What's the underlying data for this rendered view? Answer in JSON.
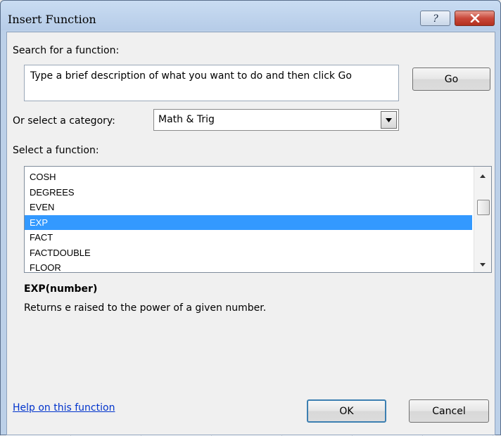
{
  "dialog": {
    "title": "Insert Function",
    "help_glyph": "?",
    "close_glyph": "✕"
  },
  "search": {
    "label": "Search for a function:",
    "value": "Type a brief description of what you want to do and then click Go",
    "go_label": "Go"
  },
  "category": {
    "label": "Or select a category:",
    "selected": "Math & Trig"
  },
  "functions": {
    "label": "Select a function:",
    "items": [
      "COSH",
      "DEGREES",
      "EVEN",
      "EXP",
      "FACT",
      "FACTDOUBLE",
      "FLOOR"
    ],
    "selected_index": 3,
    "scroll_position": 0.28
  },
  "details": {
    "signature": "EXP(number)",
    "description": "Returns e raised to the power of a given number."
  },
  "footer": {
    "help_link": "Help on this function",
    "ok_label": "OK",
    "cancel_label": "Cancel"
  },
  "colors": {
    "selection": "#3399ff",
    "link": "#0033cc",
    "close_button": "#c9483a"
  },
  "icons": {
    "help": "question-mark-icon",
    "close": "close-icon",
    "dropdown": "chevron-down-icon",
    "scroll_up": "scroll-up-arrow-icon",
    "scroll_down": "scroll-down-arrow-icon"
  }
}
